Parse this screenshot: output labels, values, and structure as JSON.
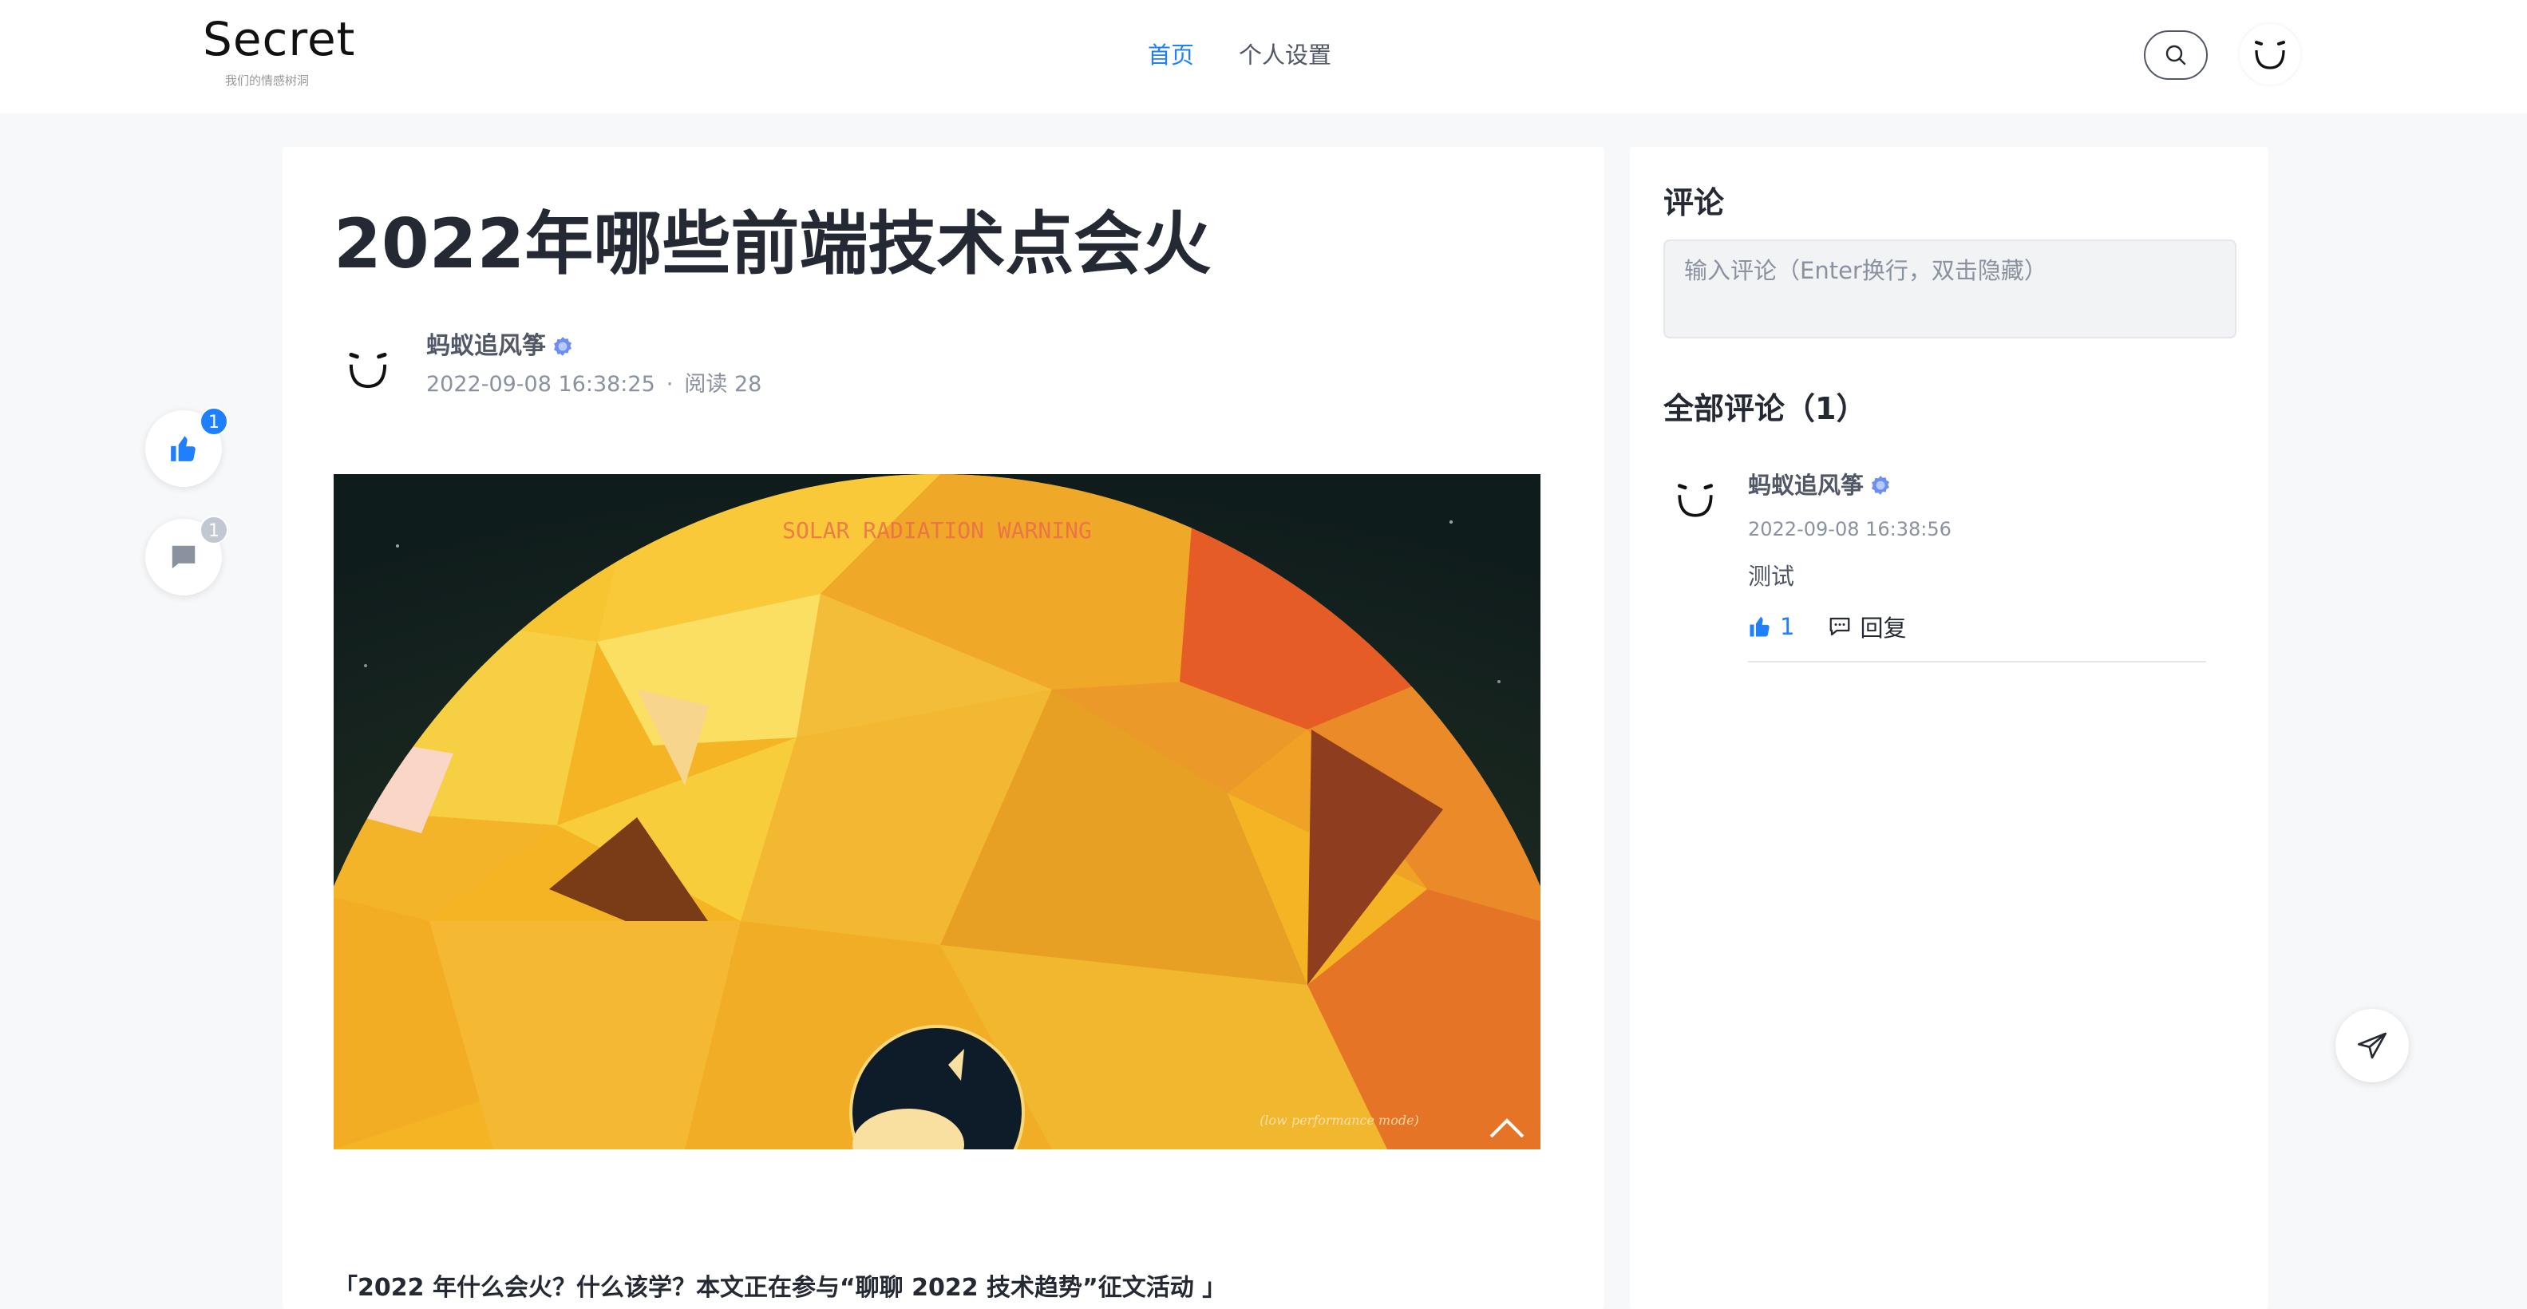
{
  "header": {
    "logo_text": "Secret",
    "logo_subtitle": "我们的情感树洞",
    "nav": [
      {
        "label": "首页",
        "active": true
      },
      {
        "label": "个人设置",
        "active": false
      }
    ]
  },
  "side_actions": {
    "like_count": "1",
    "comment_count": "1"
  },
  "article": {
    "title": "2022年哪些前端技术点会火",
    "author_name": "蚂蚁追风筝",
    "date": "2022-09-08 16:38:25",
    "separator": "·",
    "reads": "阅读 28",
    "cover_text": "SOLAR RADIATION WARNING",
    "cover_caption": "(low performance mode)",
    "intro": "「2022 年什么会火？什么该学？本文正在参与“聊聊 2022 技术趋势”征文活动 」"
  },
  "comments_panel": {
    "title": "评论",
    "input_placeholder": "输入评论（Enter换行，双击隐藏）",
    "all_title": "全部评论（1）",
    "items": [
      {
        "author": "蚂蚁追风筝",
        "time": "2022-09-08 16:38:56",
        "text": "测试",
        "likes": "1",
        "reply_label": "回复"
      }
    ]
  },
  "colors": {
    "accent": "#1e80ff",
    "text_primary": "#252933",
    "text_secondary": "#8a919f",
    "background": "#f7f8fa"
  },
  "icons": {
    "search": "search-icon",
    "avatar": "smiley-avatar-icon",
    "like": "thumbs-up-icon",
    "comment": "comment-bubble-icon",
    "reply": "reply-bubble-icon",
    "send": "paper-plane-icon",
    "verified": "verified-badge-icon"
  }
}
